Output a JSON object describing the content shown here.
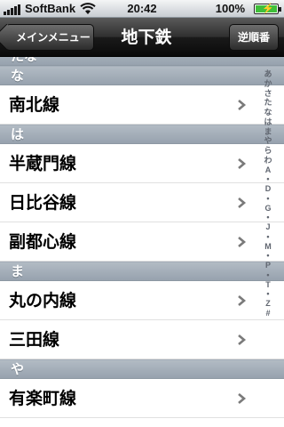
{
  "status_bar": {
    "carrier": "SoftBank",
    "time": "20:42",
    "battery": "100%",
    "battery_level": 1.0
  },
  "nav": {
    "back_label": "メインメニュー",
    "title": "地下鉄",
    "order_label": "逆順番"
  },
  "list": [
    {
      "type": "header",
      "label": "たな"
    },
    {
      "type": "header",
      "label": "な"
    },
    {
      "type": "row",
      "label": "南北線"
    },
    {
      "type": "header",
      "label": "は"
    },
    {
      "type": "row",
      "label": "半蔵門線"
    },
    {
      "type": "row",
      "label": "日比谷線"
    },
    {
      "type": "row",
      "label": "副都心線"
    },
    {
      "type": "header",
      "label": "ま"
    },
    {
      "type": "row",
      "label": "丸の内線"
    },
    {
      "type": "row",
      "label": "三田線"
    },
    {
      "type": "header",
      "label": "や"
    },
    {
      "type": "row",
      "label": "有楽町線"
    }
  ],
  "index": [
    "あ",
    "か",
    "さ",
    "た",
    "な",
    "は",
    "ま",
    "や",
    "ら",
    "わ",
    "A",
    "•",
    "D",
    "•",
    "G",
    "•",
    "J",
    "•",
    "M",
    "•",
    "P",
    "•",
    "T",
    "•",
    "Z",
    "#"
  ]
}
